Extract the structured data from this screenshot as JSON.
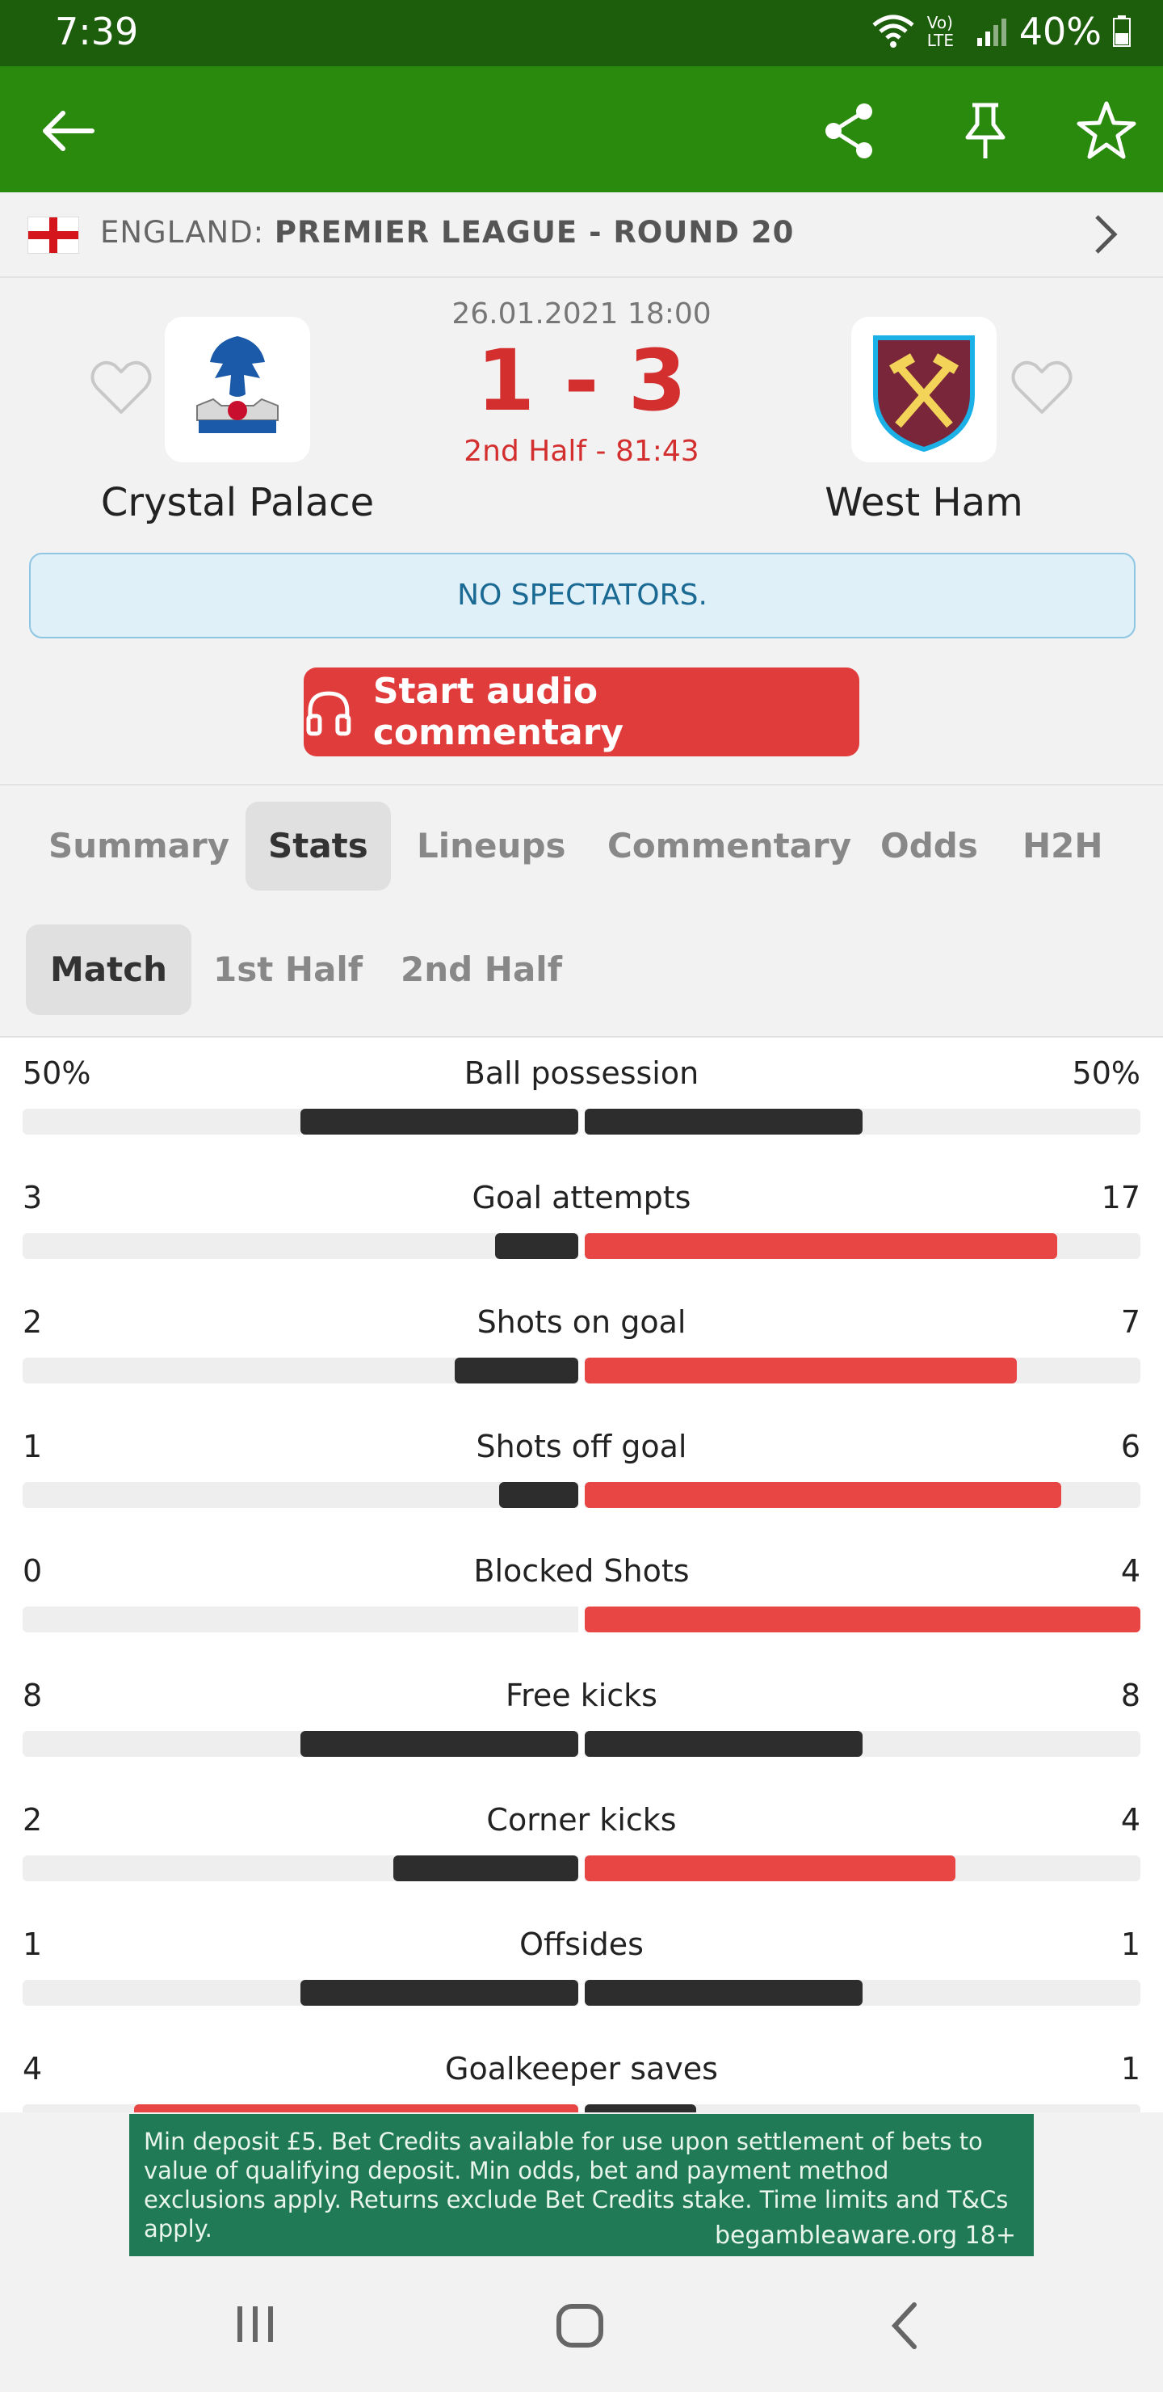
{
  "status": {
    "time": "7:39",
    "battery": "40%",
    "network": "Vo) LTE"
  },
  "league": {
    "country": "ENGLAND:",
    "name": "PREMIER LEAGUE - ROUND 20"
  },
  "match": {
    "datetime": "26.01.2021 18:00",
    "score": "1 - 3",
    "phase": "2nd Half - 81:43",
    "home": {
      "name": "Crystal Palace"
    },
    "away": {
      "name": "West Ham"
    },
    "notice": "NO SPECTATORS.",
    "audio_label": "Start audio commentary"
  },
  "tabs": [
    "Summary",
    "Stats",
    "Lineups",
    "Commentary",
    "Odds",
    "H2H"
  ],
  "subtabs": [
    "Match",
    "1st Half",
    "2nd Half"
  ],
  "colors": {
    "home_bar": "#2d2d2d",
    "away_bar": "#e84545",
    "leading": "#e84545"
  },
  "stats": [
    {
      "label": "Ball possession",
      "home": "50%",
      "away": "50%",
      "home_val": 50,
      "away_val": 50,
      "max": 100
    },
    {
      "label": "Goal attempts",
      "home": "3",
      "away": "17",
      "home_val": 3,
      "away_val": 17,
      "max": 20
    },
    {
      "label": "Shots on goal",
      "home": "2",
      "away": "7",
      "home_val": 2,
      "away_val": 7,
      "max": 9
    },
    {
      "label": "Shots off goal",
      "home": "1",
      "away": "6",
      "home_val": 1,
      "away_val": 6,
      "max": 7
    },
    {
      "label": "Blocked Shots",
      "home": "0",
      "away": "4",
      "home_val": 0,
      "away_val": 4,
      "max": 4
    },
    {
      "label": "Free kicks",
      "home": "8",
      "away": "8",
      "home_val": 8,
      "away_val": 8,
      "max": 16
    },
    {
      "label": "Corner kicks",
      "home": "2",
      "away": "4",
      "home_val": 2,
      "away_val": 4,
      "max": 6
    },
    {
      "label": "Offsides",
      "home": "1",
      "away": "1",
      "home_val": 1,
      "away_val": 1,
      "max": 2
    },
    {
      "label": "Goalkeeper saves",
      "home": "4",
      "away": "1",
      "home_val": 4,
      "away_val": 1,
      "max": 5
    }
  ],
  "ad": {
    "text": "Min deposit £5. Bet Credits available for use upon settlement of bets to value of qualifying deposit. Min odds, bet and payment method exclusions apply. Returns exclude Bet Credits stake. Time limits and T&Cs apply.",
    "footer": "begambleaware.org 18+"
  }
}
